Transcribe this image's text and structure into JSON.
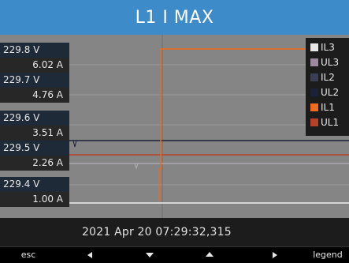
{
  "title": "L1 I MAX",
  "y_labels": [
    {
      "voltage": "229.8 V",
      "current": "6.02 A"
    },
    {
      "voltage": "229.7 V",
      "current": "4.76 A"
    },
    {
      "voltage": "229.6 V",
      "current": "3.51 A"
    },
    {
      "voltage": "229.5 V",
      "current": "2.26 A"
    },
    {
      "voltage": "229.4 V",
      "current": "1.00 A"
    }
  ],
  "legend": [
    {
      "label": "IL3",
      "color": "#e6e6e6"
    },
    {
      "label": "UL3",
      "color": "#9a8a9c"
    },
    {
      "label": "IL2",
      "color": "#3b3f52"
    },
    {
      "label": "UL2",
      "color": "#1b2238"
    },
    {
      "label": "IL1",
      "color": "#f26a1b"
    },
    {
      "label": "UL1",
      "color": "#b8412a"
    }
  ],
  "timestamp": "2021 Apr 20 07:29:32,315",
  "nav": {
    "esc": "esc",
    "left_icon": "left-arrow-icon",
    "down_icon": "down-arrow-icon",
    "up_icon": "up-arrow-icon",
    "right_icon": "right-arrow-icon",
    "legend": "legend"
  }
}
